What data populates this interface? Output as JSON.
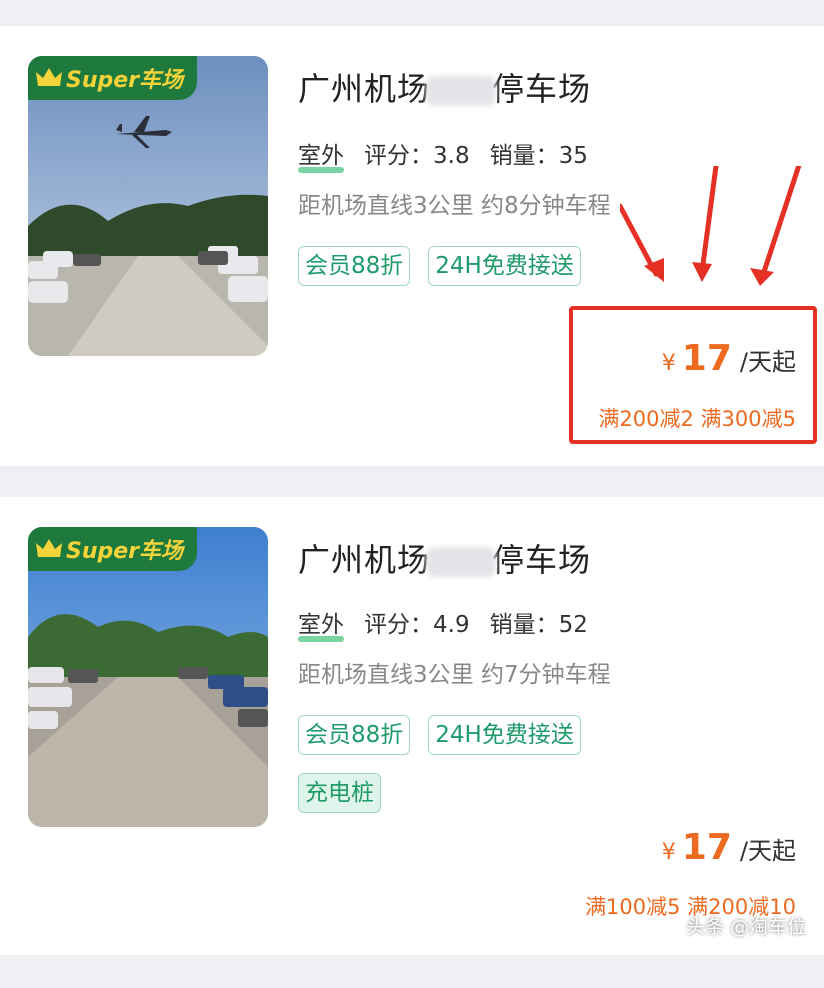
{
  "listings": [
    {
      "badge": "Super车场",
      "title_prefix": "广州机场",
      "title_suffix": "停车场",
      "type": "室外",
      "rating_label": "评分：",
      "rating": "3.8",
      "sales_label": "销量：",
      "sales": "35",
      "distance": "距机场直线3公里 约8分钟车程",
      "tags": [
        "会员88折",
        "24H免费接送"
      ],
      "price_symbol": "¥",
      "price": "17",
      "price_unit": "/天起",
      "promo": "满200减2 满300减5"
    },
    {
      "badge": "Super车场",
      "title_prefix": "广州机场",
      "title_suffix": "停车场",
      "type": "室外",
      "rating_label": "评分：",
      "rating": "4.9",
      "sales_label": "销量：",
      "sales": "52",
      "distance": "距机场直线3公里 约7分钟车程",
      "tags": [
        "会员88折",
        "24H免费接送"
      ],
      "extra_tag": "充电桩",
      "price_symbol": "¥",
      "price": "17",
      "price_unit": "/天起",
      "promo": "满100减5 满200减10"
    }
  ],
  "watermark": "头条 @淘车位",
  "colors": {
    "accent": "#ee6a21",
    "tag_green": "#1f9a6b",
    "badge_green": "#1e7a3c",
    "highlight_red": "#e53125"
  }
}
